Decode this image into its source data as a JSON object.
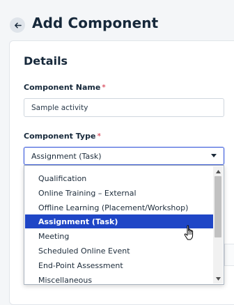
{
  "header": {
    "title": "Add Component",
    "back_icon": "arrow-left-icon"
  },
  "details": {
    "title": "Details",
    "component_name": {
      "label": "Component Name",
      "required_mark": "*",
      "value": "Sample activity"
    },
    "component_type": {
      "label": "Component Type",
      "required_mark": "*",
      "selected": "Assignment (Task)",
      "options": [
        "Qualification",
        "Online Training – External",
        "Offline Learning (Placement/Workshop)",
        "Assignment (Task)",
        "Meeting",
        "Scheduled Online Event",
        "End-Point Assessment",
        "Miscellaneous"
      ],
      "highlighted_index": 3
    }
  },
  "colors": {
    "highlight": "#1f46c6",
    "required": "#d0243a",
    "select_border": "#3b5bdb"
  }
}
